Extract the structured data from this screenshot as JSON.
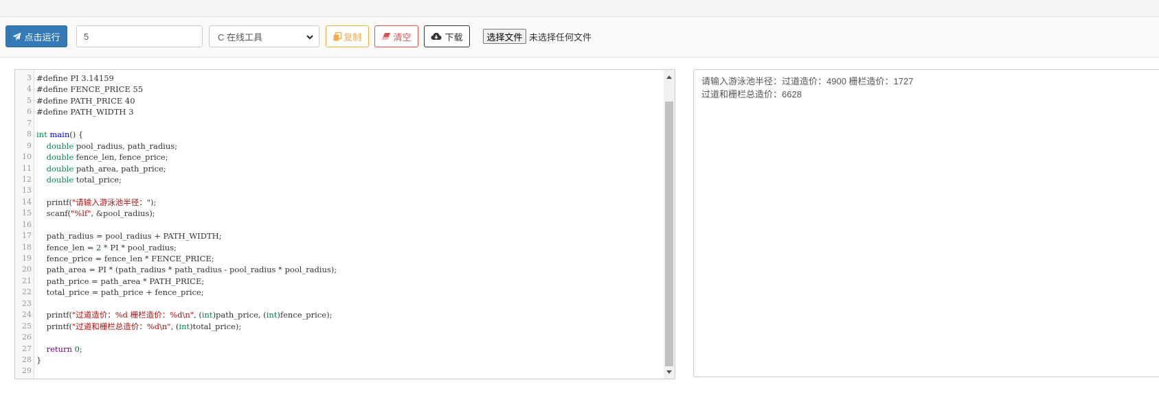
{
  "toolbar": {
    "run_label": "点击运行",
    "stdin_value": "5",
    "language_selected": "C 在线工具",
    "copy_label": "复制",
    "clear_label": "清空",
    "download_label": "下载",
    "file_button_label": "选择文件",
    "file_status": "未选择任何文件"
  },
  "icons": {
    "run": "paper-plane-icon",
    "copy": "copy-icon",
    "clear": "eraser-icon",
    "download": "cloud-download-icon"
  },
  "colors": {
    "run_button": "#337ab7",
    "copy_button": "#f0ad4e",
    "clear_button": "#d9534f",
    "keyword": "#770088",
    "type": "#008855",
    "function": "#0000ff",
    "string": "#aa1111",
    "number": "#116644"
  },
  "editor": {
    "lines": [
      {
        "n": "3",
        "tokens": [
          {
            "t": "#define PI 3.14159",
            "c": ""
          }
        ]
      },
      {
        "n": "4",
        "tokens": [
          {
            "t": "#define FENCE_PRICE 55",
            "c": ""
          }
        ]
      },
      {
        "n": "5",
        "tokens": [
          {
            "t": "#define PATH_PRICE 40",
            "c": ""
          }
        ]
      },
      {
        "n": "6",
        "tokens": [
          {
            "t": "#define PATH_WIDTH 3",
            "c": ""
          }
        ]
      },
      {
        "n": "7",
        "tokens": []
      },
      {
        "n": "8",
        "tokens": [
          {
            "t": "int",
            "c": "ty"
          },
          {
            "t": " ",
            "c": ""
          },
          {
            "t": "main",
            "c": "fn"
          },
          {
            "t": "() {",
            "c": ""
          }
        ]
      },
      {
        "n": "9",
        "tokens": [
          {
            "t": "    ",
            "c": ""
          },
          {
            "t": "double",
            "c": "ty"
          },
          {
            "t": " pool_radius, path_radius;",
            "c": ""
          }
        ]
      },
      {
        "n": "10",
        "tokens": [
          {
            "t": "    ",
            "c": ""
          },
          {
            "t": "double",
            "c": "ty"
          },
          {
            "t": " fence_len, fence_price;",
            "c": ""
          }
        ]
      },
      {
        "n": "11",
        "tokens": [
          {
            "t": "    ",
            "c": ""
          },
          {
            "t": "double",
            "c": "ty"
          },
          {
            "t": " path_area, path_price;",
            "c": ""
          }
        ]
      },
      {
        "n": "12",
        "tokens": [
          {
            "t": "    ",
            "c": ""
          },
          {
            "t": "double",
            "c": "ty"
          },
          {
            "t": " total_price;",
            "c": ""
          }
        ]
      },
      {
        "n": "13",
        "tokens": []
      },
      {
        "n": "14",
        "tokens": [
          {
            "t": "    printf(",
            "c": ""
          },
          {
            "t": "\"请输入游泳池半径：\"",
            "c": "st"
          },
          {
            "t": ");",
            "c": ""
          }
        ]
      },
      {
        "n": "15",
        "tokens": [
          {
            "t": "    scanf(",
            "c": ""
          },
          {
            "t": "\"%lf\"",
            "c": "st"
          },
          {
            "t": ", &pool_radius);",
            "c": ""
          }
        ]
      },
      {
        "n": "16",
        "tokens": []
      },
      {
        "n": "17",
        "tokens": [
          {
            "t": "    path_radius = pool_radius + PATH_WIDTH;",
            "c": ""
          }
        ]
      },
      {
        "n": "18",
        "tokens": [
          {
            "t": "    fence_len = ",
            "c": ""
          },
          {
            "t": "2",
            "c": "nm"
          },
          {
            "t": " * PI * pool_radius;",
            "c": ""
          }
        ]
      },
      {
        "n": "19",
        "tokens": [
          {
            "t": "    fence_price = fence_len * FENCE_PRICE;",
            "c": ""
          }
        ]
      },
      {
        "n": "20",
        "tokens": [
          {
            "t": "    path_area = PI * (path_radius * path_radius - pool_radius * pool_radius);",
            "c": ""
          }
        ]
      },
      {
        "n": "21",
        "tokens": [
          {
            "t": "    path_price = path_area * PATH_PRICE;",
            "c": ""
          }
        ]
      },
      {
        "n": "22",
        "tokens": [
          {
            "t": "    total_price = path_price + fence_price;",
            "c": ""
          }
        ]
      },
      {
        "n": "23",
        "tokens": []
      },
      {
        "n": "24",
        "tokens": [
          {
            "t": "    printf(",
            "c": ""
          },
          {
            "t": "\"过道造价：%d 栅栏造价：%d\\n\"",
            "c": "st"
          },
          {
            "t": ", (",
            "c": ""
          },
          {
            "t": "int",
            "c": "ty"
          },
          {
            "t": ")path_price, (",
            "c": ""
          },
          {
            "t": "int",
            "c": "ty"
          },
          {
            "t": ")fence_price);",
            "c": ""
          }
        ]
      },
      {
        "n": "25",
        "tokens": [
          {
            "t": "    printf(",
            "c": ""
          },
          {
            "t": "\"过道和栅栏总造价：%d\\n\"",
            "c": "st"
          },
          {
            "t": ", (",
            "c": ""
          },
          {
            "t": "int",
            "c": "ty"
          },
          {
            "t": ")total_price);",
            "c": ""
          }
        ]
      },
      {
        "n": "26",
        "tokens": []
      },
      {
        "n": "27",
        "tokens": [
          {
            "t": "    ",
            "c": ""
          },
          {
            "t": "return",
            "c": "kw"
          },
          {
            "t": " ",
            "c": ""
          },
          {
            "t": "0",
            "c": "nm"
          },
          {
            "t": ";",
            "c": ""
          }
        ]
      },
      {
        "n": "28",
        "tokens": [
          {
            "t": "}",
            "c": ""
          }
        ]
      },
      {
        "n": "29",
        "tokens": []
      }
    ]
  },
  "output": {
    "lines": [
      "请输入游泳池半径：过道造价：4900 栅栏造价：1727",
      "过道和栅栏总造价：6628"
    ]
  }
}
